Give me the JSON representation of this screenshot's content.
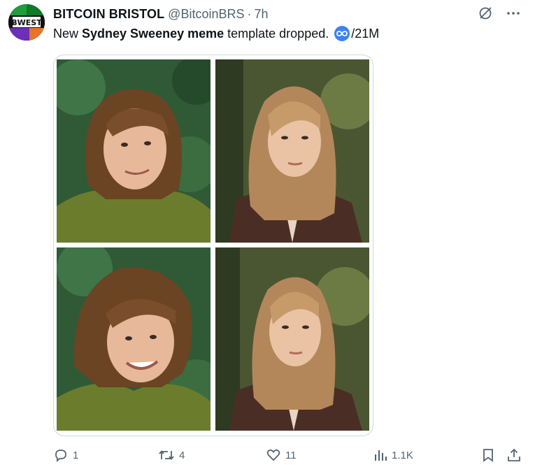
{
  "author": {
    "name": "BITCOIN BRISTOL",
    "handle": "@BitcoinBRS",
    "separator": "·",
    "time": "7h",
    "avatar_text": "ɃWEST"
  },
  "tweet": {
    "text_before": "New",
    "text_bold": "Sydney Sweeney meme",
    "text_after": "template dropped.",
    "text_tail": "/21M"
  },
  "header_icons": [
    "grok-icon",
    "more-icon"
  ],
  "actions": {
    "replies": "1",
    "reposts": "4",
    "likes": "11",
    "views": "1.1K"
  },
  "colors": {
    "text": "#0f1419",
    "muted": "#536471",
    "border": "#cfd9de",
    "chip": "#3b82f6"
  }
}
